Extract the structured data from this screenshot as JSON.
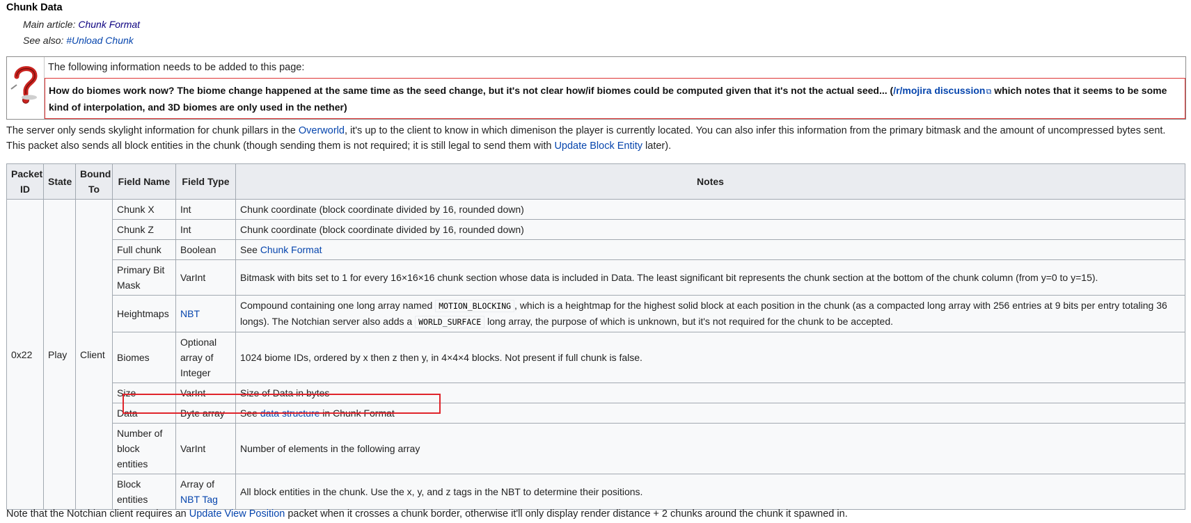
{
  "section": {
    "title": "Chunk Data",
    "main_article_prefix": "Main article: ",
    "main_article_link": "Chunk Format",
    "see_also_prefix": "See also: ",
    "see_also_link": "#Unload Chunk"
  },
  "notice": {
    "icon": "question-mark-icon",
    "header": "The following information needs to be added to this page:",
    "body_text": "How do biomes work now? The biome change happened at the same time as the seed change, but it's not clear how/if biomes could be computed given that it's not the actual seed... (",
    "body_link": "/r/mojira discussion",
    "body_text_after": " which notes that it seems to be some kind of interpolation, and 3D biomes are only used in the nether)",
    "ext_icon": "⧉"
  },
  "intro": {
    "t1": "The server only sends skylight information for chunk pillars in the ",
    "link1": "Overworld",
    "t2": ", it's up to the client to know in which dimenison the player is currently located. You can also infer this information from the primary bitmask and the amount of uncompressed bytes sent. This packet also sends all block entities in the chunk (though sending them is not required; it is still legal to send them with ",
    "link2": "Update Block Entity",
    "t3": " later)."
  },
  "table": {
    "headers": {
      "packet_id": "Packet ID",
      "state": "State",
      "bound_to": "Bound To",
      "field_name": "Field Name",
      "field_type": "Field Type",
      "notes": "Notes"
    },
    "packet_id": "0x22",
    "state": "Play",
    "bound_to": "Client",
    "rows": [
      {
        "name": "Chunk X",
        "type": "Int",
        "notes": "Chunk coordinate (block coordinate divided by 16, rounded down)"
      },
      {
        "name": "Chunk Z",
        "type": "Int",
        "notes": "Chunk coordinate (block coordinate divided by 16, rounded down)"
      },
      {
        "name": "Full chunk",
        "type": "Boolean",
        "notes_prefix": "See ",
        "notes_link": "Chunk Format"
      },
      {
        "name": "Primary Bit Mask",
        "type": "VarInt",
        "notes": "Bitmask with bits set to 1 for every 16×16×16 chunk section whose data is included in Data. The least significant bit represents the chunk section at the bottom of the chunk column (from y=0 to y=15)."
      },
      {
        "name": "Heightmaps",
        "type_link": "NBT",
        "notes_p1": "Compound containing one long array named ",
        "notes_code1": "MOTION_BLOCKING",
        "notes_p2": ", which is a heightmap for the highest solid block at each position in the chunk (as a compacted long array with 256 entries at 9 bits per entry totaling 36 longs). The Notchian server also adds a ",
        "notes_code2": "WORLD_SURFACE",
        "notes_p3": " long array, the purpose of which is unknown, but it's not required for the chunk to be accepted."
      },
      {
        "name": "Biomes",
        "type": "Optional array of Integer",
        "notes": "1024 biome IDs, ordered by x then z then y, in 4×4×4 blocks. Not present if full chunk is false."
      },
      {
        "name": "Size",
        "type": "VarInt",
        "notes": "Size of Data in bytes"
      },
      {
        "name": "Data",
        "type": "Byte array",
        "notes_prefix": "See ",
        "notes_link": "data structure",
        "notes_suffix": " in Chunk Format"
      },
      {
        "name": "Number of block entities",
        "type": "VarInt",
        "notes": "Number of elements in the following array"
      },
      {
        "name": "Block entities",
        "type_prefix": "Array of ",
        "type_link": "NBT Tag",
        "notes": "All block entities in the chunk. Use the x, y, and z tags in the NBT to determine their positions."
      }
    ]
  },
  "outro": {
    "t1": "Note that the Notchian client requires an ",
    "link1": "Update View Position",
    "t2": " packet when it crosses a chunk border, otherwise it'll only display render distance + 2 chunks around the chunk it spawned in."
  },
  "colors": {
    "link": "#0645ad",
    "highlight_border": "#e0242b",
    "notice_border": "#dd3333",
    "header_bg": "#eaecf0"
  }
}
